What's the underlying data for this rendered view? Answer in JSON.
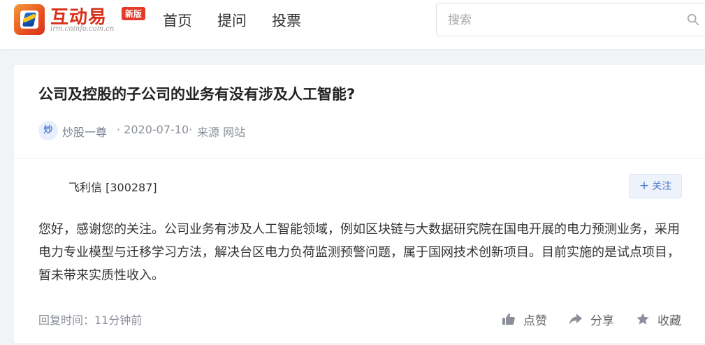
{
  "header": {
    "logo": {
      "name": "互动易",
      "domain": "irm.cninfo.com.cn",
      "badge": "新版"
    },
    "nav": [
      {
        "label": "首页"
      },
      {
        "label": "提问"
      },
      {
        "label": "投票"
      }
    ],
    "search": {
      "placeholder": "搜索",
      "value": ""
    }
  },
  "question": {
    "title": "公司及控股的子公司的业务有没有涉及人工智能?",
    "avatar_text": "炒",
    "author": "炒股一尊",
    "date": "· 2020-07-10·",
    "source": "来源 网站"
  },
  "answer": {
    "company": "飞利信 [300287]",
    "follow_label": "关注",
    "text": "您好，感谢您的关注。公司业务有涉及人工智能领域，例如区块链与大数据研究院在国电开展的电力预测业务，采用电力专业模型与迁移学习方法，解决台区电力负荷监测预警问题，属于国网技术创新项目。目前实施的是试点项目，暂未带来实质性收入。",
    "reply_time": "回复时间：11分钟前",
    "actions": [
      {
        "label": "点赞",
        "icon": "thumbs-up-icon"
      },
      {
        "label": "分享",
        "icon": "share-icon"
      },
      {
        "label": "收藏",
        "icon": "star-icon"
      }
    ]
  },
  "colors": {
    "brand_red": "#d63019",
    "link_blue": "#4a78c8",
    "muted": "#8a8f99"
  }
}
